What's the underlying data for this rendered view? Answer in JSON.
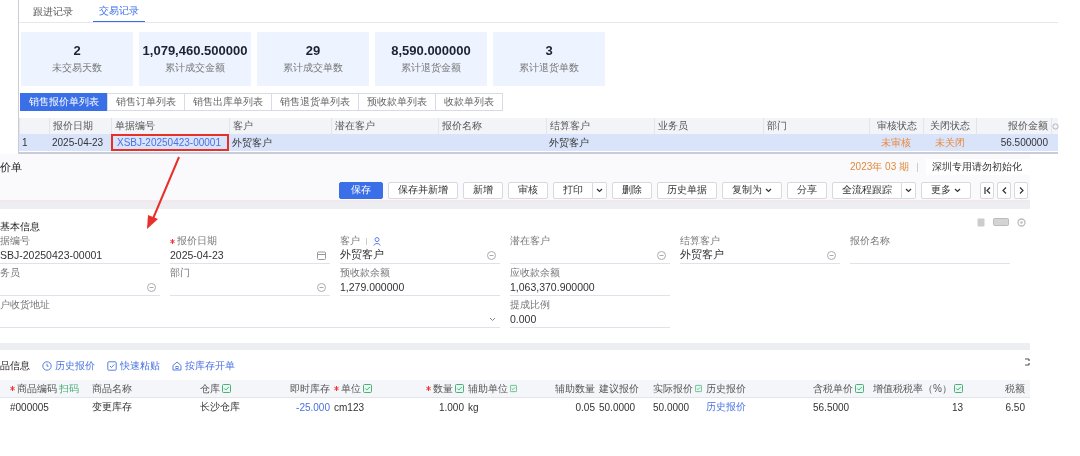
{
  "record_tabs": [
    {
      "label": "跟进记录",
      "selected": false
    },
    {
      "label": "交易记录",
      "selected": true
    }
  ],
  "stats": [
    {
      "value": "2",
      "label": "未交易天数"
    },
    {
      "value": "1,079,460.500000",
      "label": "累计成交金额"
    },
    {
      "value": "29",
      "label": "累计成交单数"
    },
    {
      "value": "8,590.000000",
      "label": "累计退货金额"
    },
    {
      "value": "3",
      "label": "累计退货单数"
    }
  ],
  "list_tabs": [
    {
      "label": "销售报价单列表",
      "selected": true
    },
    {
      "label": "销售订单列表",
      "selected": false
    },
    {
      "label": "销售出库单列表",
      "selected": false
    },
    {
      "label": "销售退货单列表",
      "selected": false
    },
    {
      "label": "预收款单列表",
      "selected": false
    },
    {
      "label": "收款单列表",
      "selected": false
    }
  ],
  "list_table": {
    "columns": [
      {
        "label": "报价日期",
        "kind": "text"
      },
      {
        "label": "单据编号",
        "kind": "link"
      },
      {
        "label": "客户",
        "kind": "text"
      },
      {
        "label": "潜在客户",
        "kind": "text"
      },
      {
        "label": "报价名称",
        "kind": "text"
      },
      {
        "label": "结算客户",
        "kind": "text"
      },
      {
        "label": "业务员",
        "kind": "text"
      },
      {
        "label": "部门",
        "kind": "text"
      },
      {
        "label": "审核状态",
        "kind": "status"
      },
      {
        "label": "关闭状态",
        "kind": "status"
      },
      {
        "label": "报价金额",
        "kind": "amount"
      }
    ],
    "rows": [
      {
        "index": "1",
        "selected": true,
        "link_boxed": true,
        "cells": [
          {
            "text": "2025-04-23"
          },
          {
            "text": "XSBJ-20250423-00001"
          },
          {
            "text": "外贸客户"
          },
          {},
          {},
          {
            "text": "外贸客户"
          },
          {},
          {},
          {
            "text": "未审核"
          },
          {
            "text": "未关闭"
          },
          {
            "text": "56.500000"
          }
        ]
      }
    ]
  },
  "form": {
    "title": "价单",
    "period": "2023年 03 期",
    "account": "深圳专用请勿初始化",
    "toolbar": [
      {
        "label": "保存",
        "kind": "primary"
      },
      {
        "label": "保存并新增",
        "kind": "plain"
      },
      {
        "label": "新增",
        "kind": "plain"
      },
      {
        "label": "审核",
        "kind": "plain"
      },
      {
        "label": "打印",
        "kind": "split"
      },
      {
        "label": "删除",
        "kind": "plain"
      },
      {
        "label": "历史单据",
        "kind": "plain"
      },
      {
        "label": "复制为",
        "kind": "dropdown"
      },
      {
        "label": "分享",
        "kind": "plain"
      },
      {
        "label": "全流程跟踪",
        "kind": "split"
      },
      {
        "label": "更多",
        "kind": "dropdown"
      }
    ],
    "section_title": "基本信息",
    "fields": [
      {
        "label": "据编号",
        "kind": "text",
        "required": false,
        "value": "SBJ-20250423-00001"
      },
      {
        "label": "报价日期",
        "kind": "date",
        "required": true,
        "value": "2025-04-23"
      },
      {
        "label": "客户",
        "kind": "customer",
        "required": false,
        "value": "外贸客户"
      },
      {
        "label": "潜在客户",
        "kind": "select",
        "required": false
      },
      {
        "label": "结算客户",
        "kind": "select",
        "required": false,
        "value": "外贸客户"
      },
      {
        "label": "报价名称",
        "kind": "text",
        "required": false
      },
      {
        "label": "务员",
        "kind": "select",
        "required": false
      },
      {
        "label": "部门",
        "kind": "select",
        "required": false
      },
      {
        "label": "预收款余额",
        "kind": "text",
        "required": false,
        "value": "1,279.000000"
      },
      {
        "label": "应收款余额",
        "kind": "text",
        "required": false,
        "value": "1,063,370.900000"
      },
      {
        "label": "户收货地址",
        "kind": "address",
        "required": false
      },
      {
        "label": "提成比例",
        "kind": "text",
        "required": false,
        "value": "0.000"
      }
    ]
  },
  "goods": {
    "title": "品信息",
    "actions": [
      {
        "label": "历史报价",
        "kind": "history"
      },
      {
        "label": "快速粘贴",
        "kind": "paste"
      },
      {
        "label": "按库存开单",
        "kind": "stock"
      }
    ],
    "columns": [
      {
        "label": "商品编码",
        "kind": "text",
        "required": true,
        "editable": false,
        "scan": "扫码"
      },
      {
        "label": "商品名称",
        "kind": "text",
        "required": false,
        "editable": false
      },
      {
        "label": "仓库",
        "kind": "text",
        "required": false,
        "editable": true
      },
      {
        "label": "即时库存",
        "kind": "stock",
        "required": false,
        "editable": false
      },
      {
        "label": "单位",
        "kind": "text",
        "required": true,
        "editable": true
      },
      {
        "label": "数量",
        "kind": "number",
        "required": true,
        "editable": true
      },
      {
        "label": "辅助单位",
        "kind": "text",
        "required": false,
        "editable": true
      },
      {
        "label": "辅助数量",
        "kind": "number",
        "required": false,
        "editable": false
      },
      {
        "label": "建议报价",
        "kind": "text",
        "required": false,
        "editable": false
      },
      {
        "label": "实际报价",
        "kind": "text",
        "required": false,
        "editable": true
      },
      {
        "label": "历史报价",
        "kind": "link",
        "required": false,
        "editable": false
      },
      {
        "label": "含税单价",
        "kind": "text",
        "required": false,
        "editable": true
      },
      {
        "label": "增值税税率（%）",
        "kind": "number",
        "required": false,
        "editable": true
      },
      {
        "label": "税额",
        "kind": "number",
        "required": false,
        "editable": false
      }
    ],
    "rows": [
      {
        "cells": [
          "#000005",
          "变更库存",
          "长沙仓库",
          "-25.000",
          "cm123",
          "1.000",
          "kg",
          "0.05",
          "50.0000",
          "50.0000",
          "历史报价",
          "56.5000",
          "13",
          "6.50"
        ]
      }
    ]
  }
}
